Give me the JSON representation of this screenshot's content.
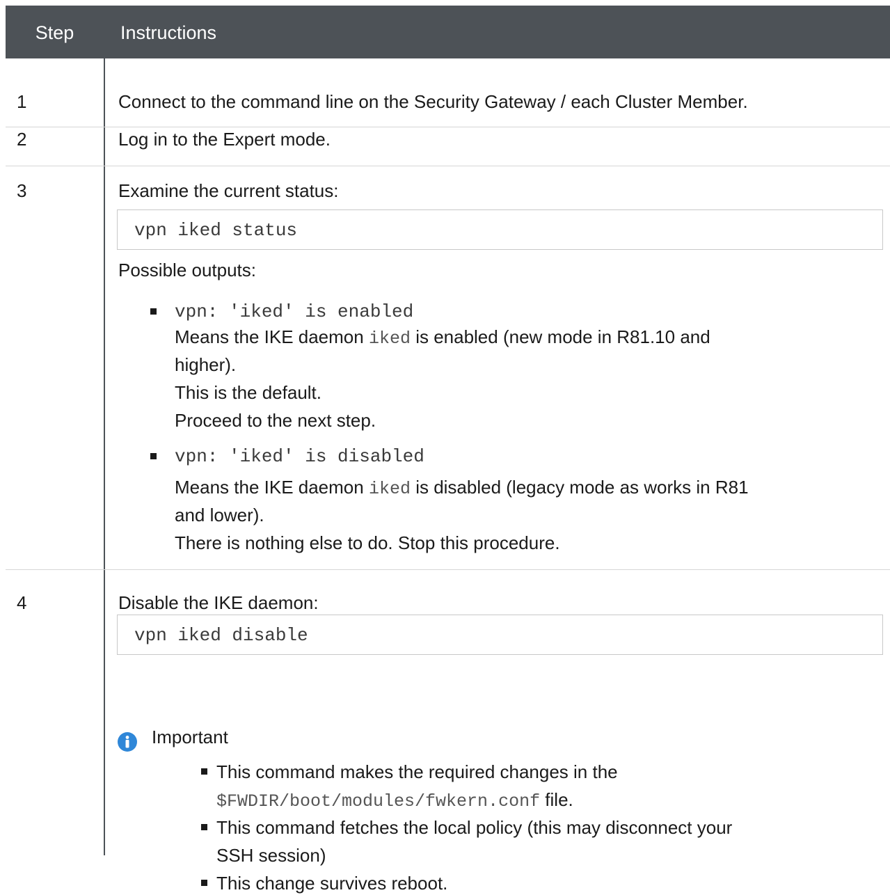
{
  "header": {
    "step": "Step",
    "instructions": "Instructions"
  },
  "steps": [
    {
      "num": "1",
      "text": "Connect to the command line on the Security Gateway / each Cluster Member."
    },
    {
      "num": "2",
      "text": "Log in to the Expert mode."
    },
    {
      "num": "3",
      "text": "Examine the current status:",
      "code": "vpn iked status",
      "outputs_label": "Possible outputs:",
      "outputs": [
        {
          "code": "vpn: 'iked' is enabled",
          "desc_prefix": "Means the IKE daemon ",
          "desc_code": "iked",
          "desc_suffix": " is enabled (new mode in R81.10 and",
          "desc_cont": "higher).",
          "lines": [
            "This is the default.",
            "Proceed to the next step."
          ]
        },
        {
          "code": "vpn: 'iked' is disabled",
          "desc_prefix": "Means the IKE daemon ",
          "desc_code": "iked",
          "desc_suffix": " is disabled (legacy mode as works in R81",
          "desc_cont": "and lower).",
          "lines": [
            "There is nothing else to do. Stop this procedure."
          ]
        }
      ]
    },
    {
      "num": "4",
      "text": "Disable the IKE daemon:",
      "code": "vpn iked disable",
      "important_label": "Important",
      "important_items": [
        {
          "line1": "This command makes the required changes in the",
          "line2_code": "$FWDIR/boot/modules/fwkern.conf",
          "line2_suffix": " file."
        },
        {
          "line1": "This command fetches the local policy (this may disconnect your",
          "line2": "SSH session)"
        },
        {
          "line1": "This change survives reboot."
        }
      ]
    }
  ],
  "colors": {
    "header_bg": "#4d5257",
    "info_icon": "#2f87d8"
  },
  "icons": {
    "info": "info-circle-icon",
    "bullet": "square-bullet-icon"
  }
}
